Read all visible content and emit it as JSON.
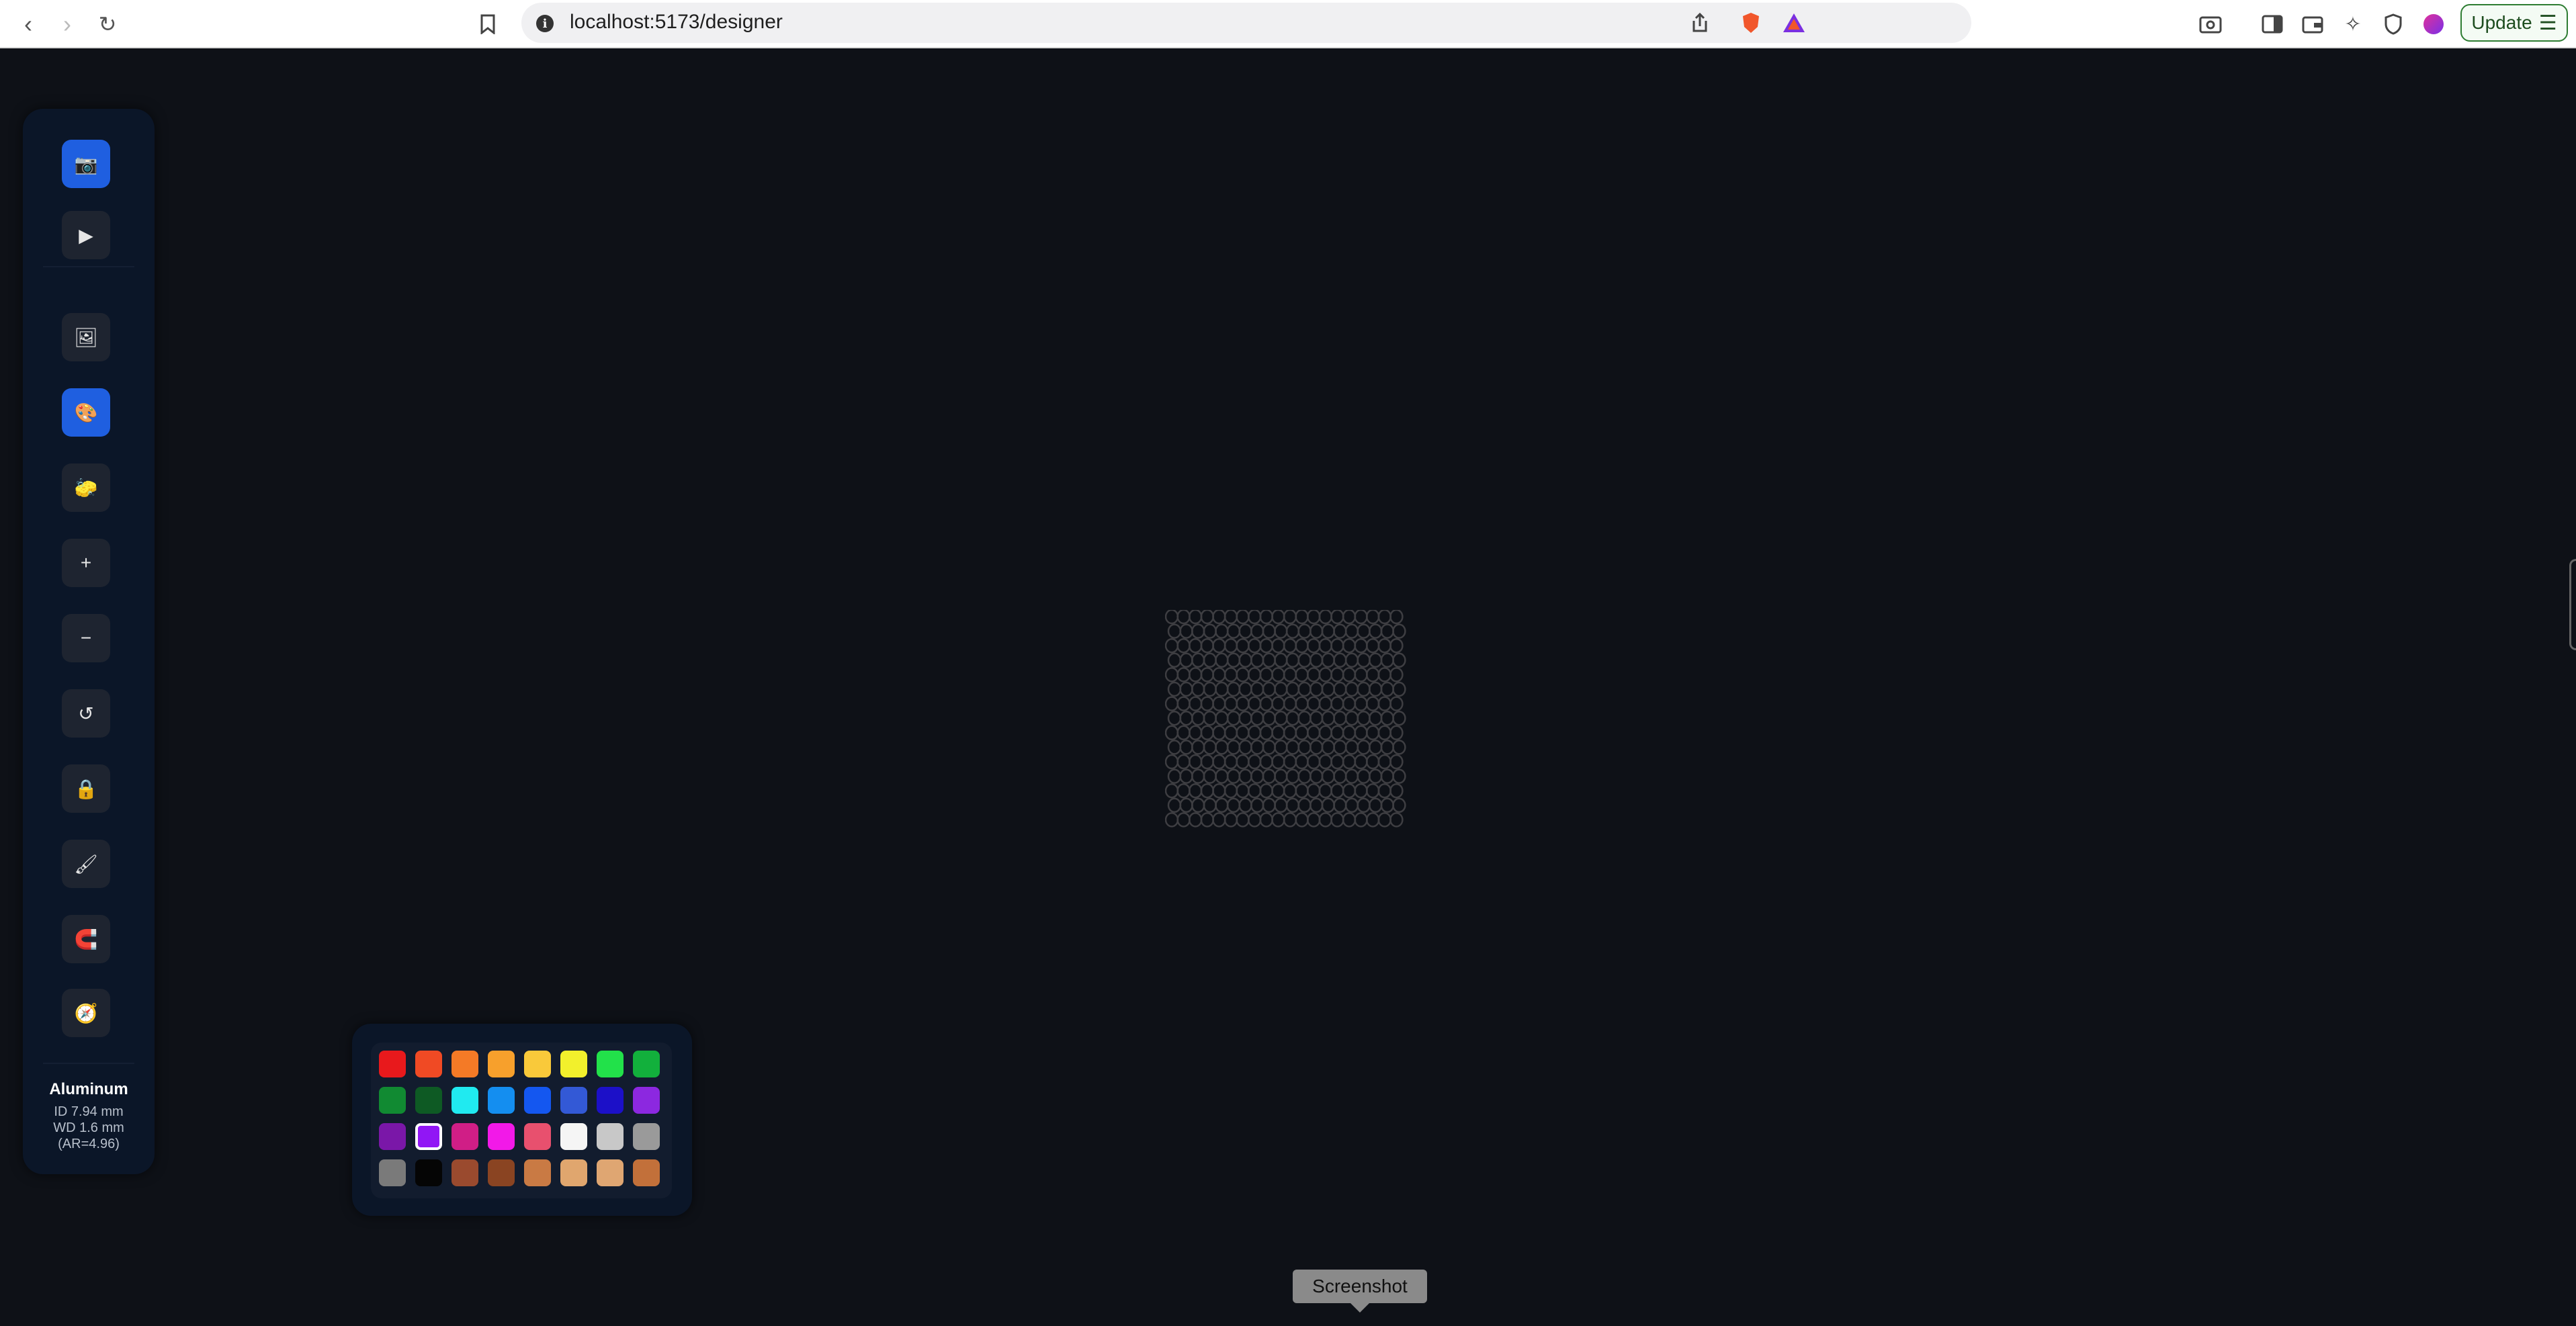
{
  "browser": {
    "url": "localhost:5173/designer",
    "update_label": "Update",
    "icons": [
      "back-icon",
      "forward-icon",
      "reload-icon",
      "bookmark-icon",
      "share-icon",
      "brave-shield-icon",
      "brave-rewards-icon",
      "screenshot-icon",
      "sidebar-icon",
      "wallet-icon",
      "leo-ai-icon",
      "vpn-icon",
      "profile-icon",
      "menu-icon"
    ]
  },
  "toolbar": {
    "tools": [
      {
        "name": "camera-icon",
        "glyph": "📷",
        "active": true
      },
      {
        "name": "play-icon",
        "glyph": "▶",
        "active": false
      },
      {
        "name": "image-icon",
        "glyph": "🖼",
        "active": false
      },
      {
        "name": "palette-icon",
        "glyph": "🎨",
        "active": true
      },
      {
        "name": "eraser-icon",
        "glyph": "🧽",
        "active": false
      },
      {
        "name": "zoom-in-icon",
        "glyph": "+",
        "active": false
      },
      {
        "name": "zoom-out-icon",
        "glyph": "−",
        "active": false
      },
      {
        "name": "reset-icon",
        "glyph": "↺",
        "active": false
      },
      {
        "name": "lock-icon",
        "glyph": "🔒",
        "active": false
      },
      {
        "name": "brush-icon",
        "glyph": "🖌",
        "active": false
      },
      {
        "name": "magnet-icon",
        "glyph": "🧲",
        "active": false
      },
      {
        "name": "gauge-icon",
        "glyph": "🧭",
        "active": false
      }
    ],
    "material": {
      "name": "Aluminum",
      "id": "ID 7.94 mm",
      "wd": "WD 1.6 mm",
      "ar": "(AR=4.96)"
    }
  },
  "palette": {
    "colors": [
      "#e8191c",
      "#f04a24",
      "#f47a26",
      "#f7a02c",
      "#f9c93a",
      "#f2f02c",
      "#22e14a",
      "#12b03c",
      "#118a32",
      "#0e5a24",
      "#20eaf0",
      "#148ef0",
      "#1457f0",
      "#3359d6",
      "#1c10c8",
      "#8c28e0",
      "#7a17a8",
      "#9116f5",
      "#d01e86",
      "#f219e8",
      "#e8506e",
      "#f5f5f5",
      "#c8c8c8",
      "#9a9a9a",
      "#7a7a7a",
      "#050505",
      "#9a4a2e",
      "#8a4422",
      "#c97a44",
      "#e0a66e",
      "#dfa672",
      "#c2703a"
    ],
    "selected_index": 17
  },
  "tooltip": {
    "label": "Screenshot"
  }
}
